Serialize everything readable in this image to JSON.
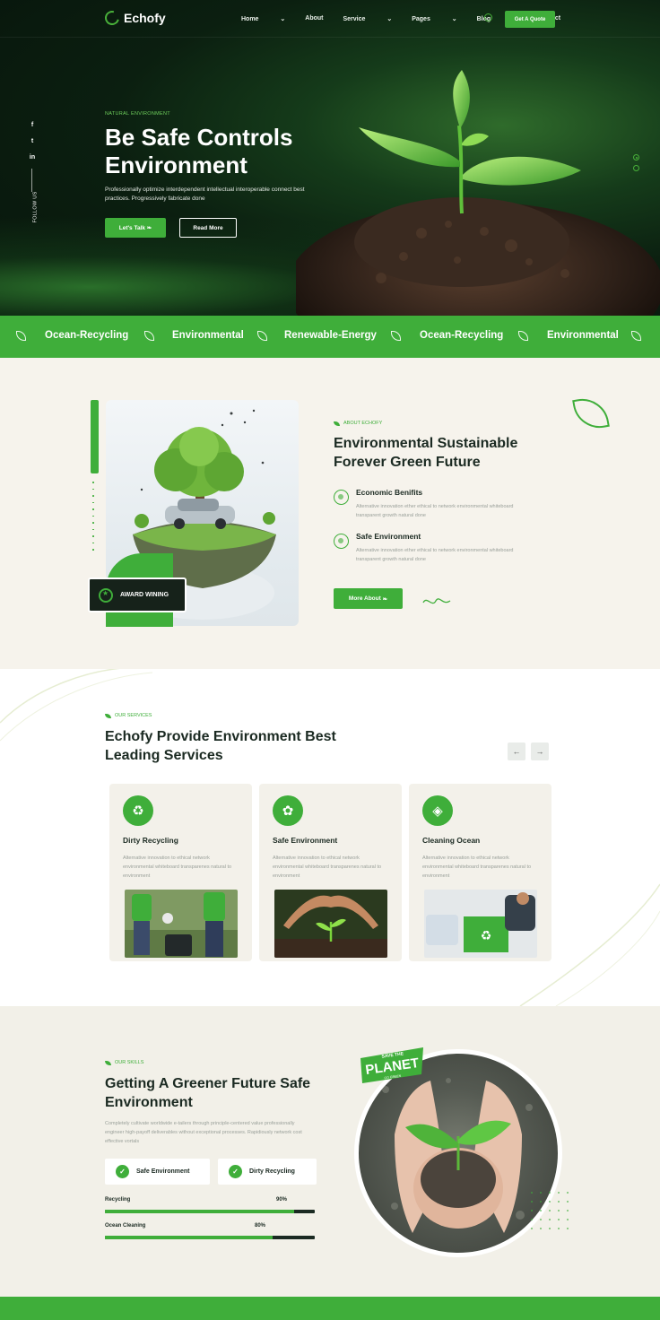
{
  "brand": {
    "name": "Echofy",
    "accent": "#3fae3a"
  },
  "nav": {
    "items": [
      "Home",
      "About",
      "Service",
      "Pages",
      "Blog",
      "Contact"
    ],
    "dropdown": [
      true,
      false,
      true,
      true,
      true,
      false
    ],
    "cta": "Get A Quote"
  },
  "hero": {
    "kicker": "NATURAL ENVIRONMENT",
    "title": "Be Safe Controls Environment",
    "description": "Professionally optimize interdependent intellectual interoperable connect best practices. Progressively fabricate done",
    "primary_cta": "Let's Talk",
    "secondary_cta": "Read More",
    "social": [
      "f",
      "t",
      "in"
    ],
    "follow_label": "FOLLOW US"
  },
  "marquee": [
    "Ocean-Recycling",
    "Environmental",
    "Renewable-Energy",
    "Ocean-Recycling",
    "Environmental"
  ],
  "about": {
    "kicker": "ABOUT ECHOFY",
    "title": "Environmental Sustainable Forever Green Future",
    "award": "AWARD WINING",
    "features": [
      {
        "title": "Economic Benifits",
        "desc": "Alternative innovation ether ethical to network environmental whiteboard transparent growth natural done",
        "icon": "coins-icon"
      },
      {
        "title": "Safe Environment",
        "desc": "Alternative innovation ether ethical to network environmental whiteboard transparent growth natural done",
        "icon": "globe-hand-icon"
      }
    ],
    "cta": "More About"
  },
  "services": {
    "kicker": "OUR SERVICES",
    "title": "Echofy Provide Environment Best Leading Services",
    "prev": "←",
    "next": "→",
    "cards": [
      {
        "title": "Dirty Recycling",
        "desc": "Alternative innovation to ethical network environmental whiteboard transparenes natural to environment",
        "icon": "recycle-icon",
        "glyph": "♻"
      },
      {
        "title": "Safe Environment",
        "desc": "Alternative innovation to ethical network environmental whiteboard transparenes natural to environment",
        "icon": "hand-plant-icon",
        "glyph": "✿"
      },
      {
        "title": "Cleaning Ocean",
        "desc": "Alternative innovation to ethical network environmental whiteboard transparenes natural to environment",
        "icon": "water-drop-icon",
        "glyph": "◈"
      }
    ]
  },
  "skills": {
    "kicker": "OUR SKILLS",
    "title": "Getting A Greener Future Safe Environment",
    "description": "Completely cultivate worldwide e-tailers through principle-centered value professionally engineer high-payoff deliverables without exceptional processes. Rapidiously network cost effective vortals",
    "pills": [
      "Safe Environment",
      "Dirty Recycling"
    ],
    "bars": [
      {
        "label": "Recycling",
        "percent": 90,
        "display": "90%"
      },
      {
        "label": "Ocean Cleaning",
        "percent": 80,
        "display": "80%"
      }
    ],
    "badge_top": "SAVE THE",
    "badge_main": "PLANET",
    "badge_bottom": "GO GREEN"
  }
}
